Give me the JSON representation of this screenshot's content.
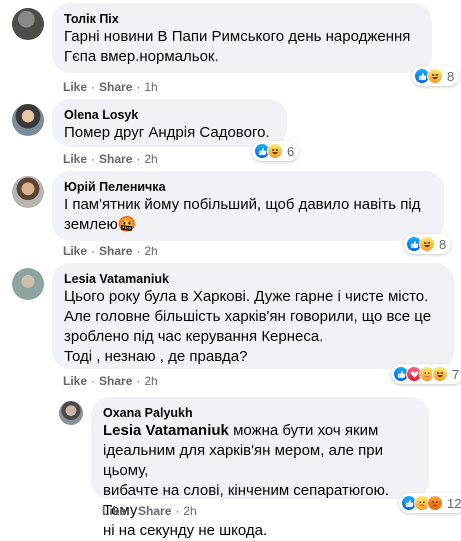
{
  "comments": [
    {
      "author": "Толік Піх",
      "lines": [
        "Гарні новини В Папи Римського день народження",
        "Гєпа вмер.нормальок."
      ],
      "actions": {
        "like": "Like",
        "share": "Share",
        "time": "1h"
      },
      "reactions": {
        "icons": [
          "like-icon",
          "haha-icon"
        ],
        "count": "8"
      }
    },
    {
      "author": "Olena Losyk",
      "lines": [
        "Помер друг Андрія Садового."
      ],
      "actions": {
        "like": "Like",
        "share": "Share",
        "time": "2h"
      },
      "reactions": {
        "icons": [
          "like-icon",
          "haha-icon"
        ],
        "count": "6"
      }
    },
    {
      "author": "Юрій Пеленичка",
      "lines": [
        "І пам'ятник йому побільший, щоб давило навіть під",
        "землею🤬"
      ],
      "actions": {
        "like": "Like",
        "share": "Share",
        "time": "2h"
      },
      "reactions": {
        "icons": [
          "like-icon",
          "haha-icon"
        ],
        "count": "8"
      }
    },
    {
      "author": "Lesia Vatamaniuk",
      "lines": [
        "Цього року була в Харкові. Дуже гарне і чисте місто.",
        "Але головне більшість харків'ян говорили, що все це",
        "зроблено під час керування Кернеса.",
        "Тоді , незнаю , де правда?"
      ],
      "actions": {
        "like": "Like",
        "share": "Share",
        "time": "2h"
      },
      "reactions": {
        "icons": [
          "like-icon",
          "love-icon",
          "care-icon",
          "haha-icon"
        ],
        "count": "7"
      }
    },
    {
      "author": "Oxana Palyukh",
      "mention": "Lesia Vatamaniuk",
      "lines": [
        " можна бути хоч яким",
        "ідеальним для харків'ян мером, але при цьому,",
        "вибачте на слові, кінченим сепаратюгою. Тому",
        "ні на секунду не шкода."
      ],
      "actions": {
        "like": "Like",
        "share": "Share",
        "time": "2h"
      },
      "reactions": {
        "icons": [
          "like-icon",
          "sad-icon",
          "angry-icon"
        ],
        "count": "12"
      }
    }
  ],
  "colors": {
    "bubble": "#f0f2f5",
    "meta": "#65676b",
    "like_blue": "#1877f2"
  }
}
